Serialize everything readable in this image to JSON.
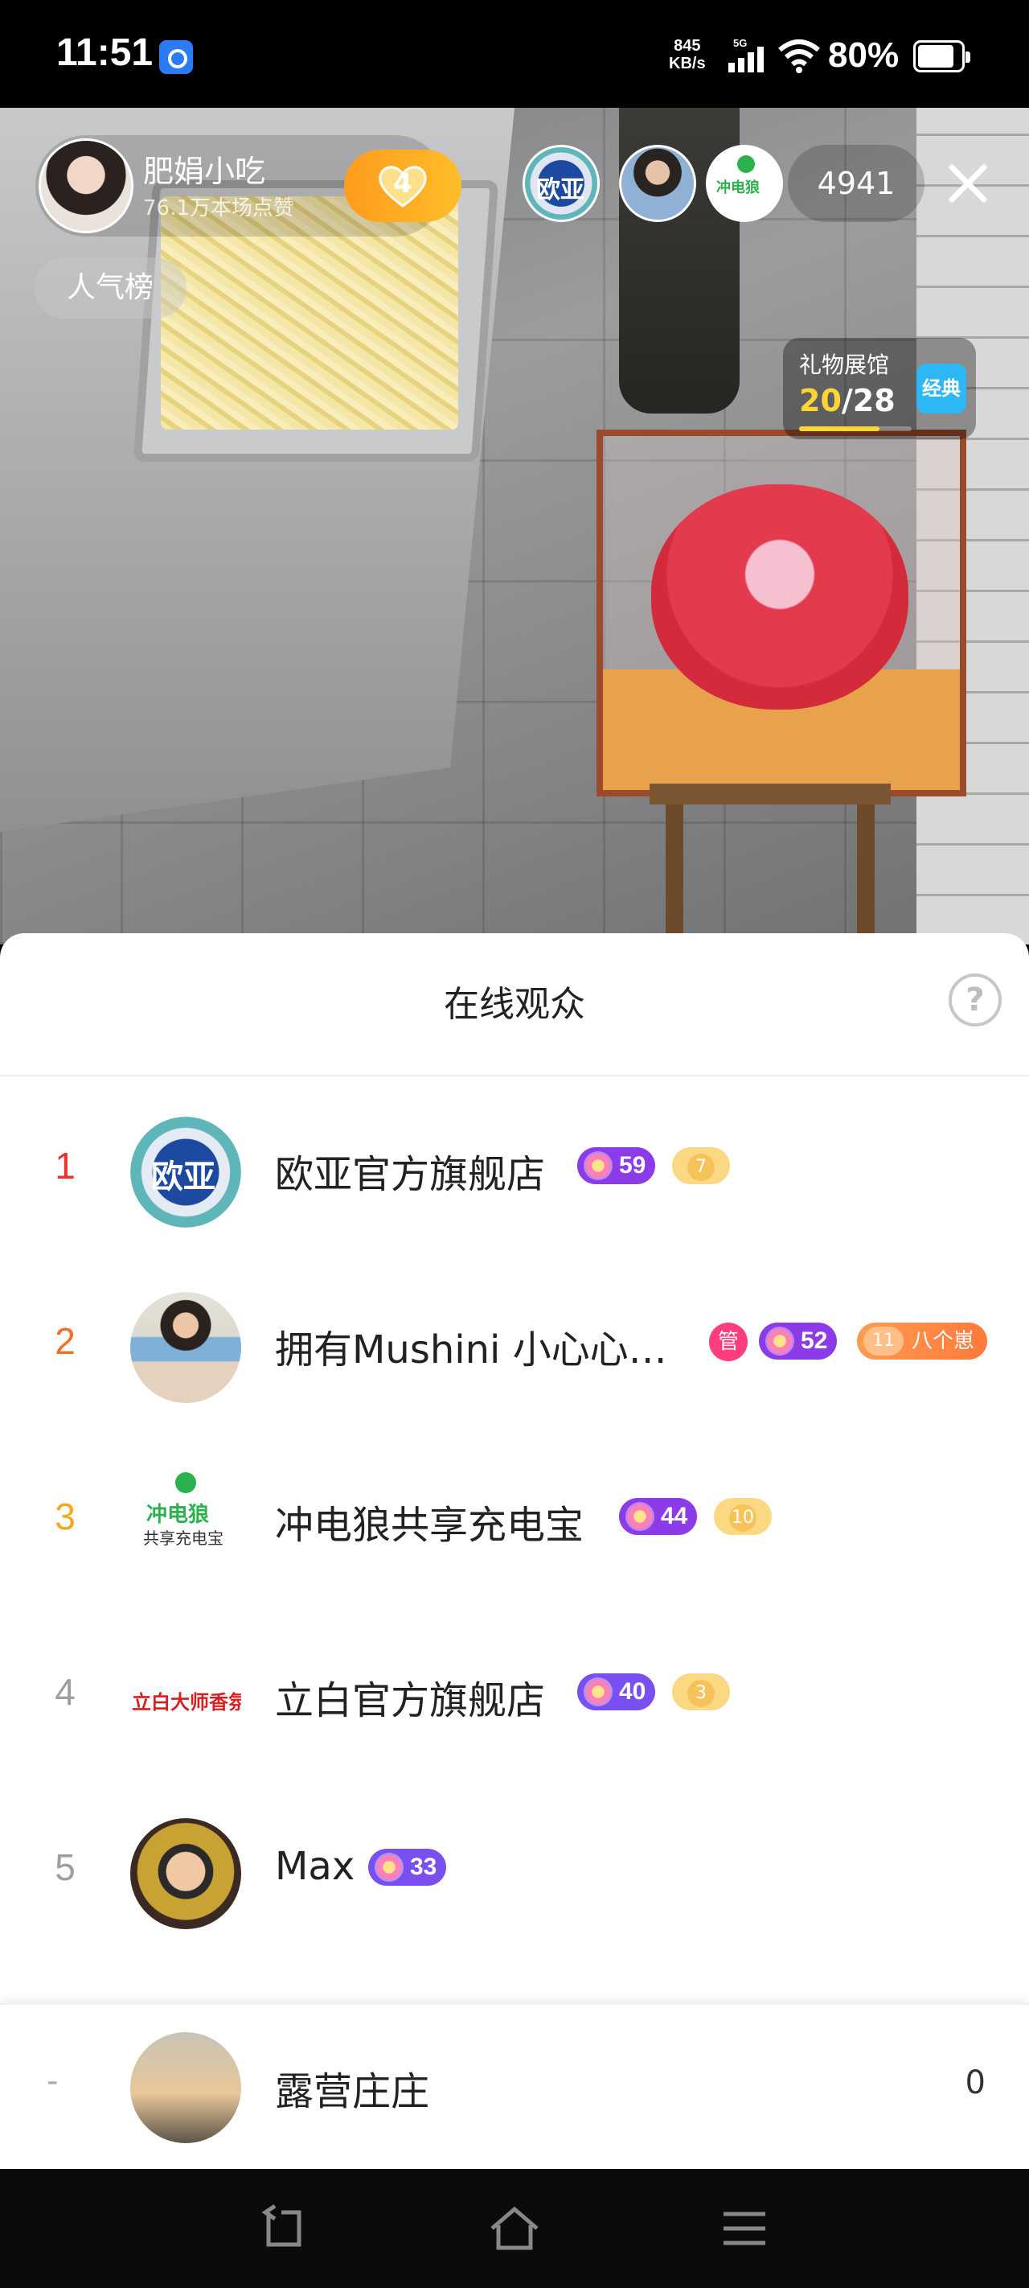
{
  "status_bar": {
    "time": "11:51",
    "net_speed_value": "845",
    "net_speed_unit": "KB/s",
    "network": "5G",
    "battery_percent": "80%",
    "battery_level": 0.8
  },
  "live": {
    "host_name": "肥娟小吃",
    "host_likes": "76.1万本场点赞",
    "follow_badge_number": "4",
    "popularity_label": "人气榜",
    "viewer_count": "4941",
    "top_viewer_avatars": [
      "欧亚官方旗舰店",
      "拥有Mushini 小心心…",
      "冲电狼共享充电宝"
    ],
    "gift_hall": {
      "label": "礼物展馆",
      "current": "20",
      "total": "/28",
      "progress": 0.714,
      "badge": "经典"
    }
  },
  "sheet": {
    "title": "在线观众",
    "viewers": [
      {
        "rank": "1",
        "rank_color": "#f0302f",
        "name": "欧亚官方旗舰店",
        "fan_level": "59",
        "fan_color": "#8b3be8",
        "coin": "7"
      },
      {
        "rank": "2",
        "rank_color": "#f06f2a",
        "name": "拥有Mushini 小心心…",
        "manager": "管",
        "fan_level": "52",
        "fan_color": "#8b3be8",
        "group_level": "11",
        "group_name": "八个崽"
      },
      {
        "rank": "3",
        "rank_color": "#f3a91a",
        "name": "冲电狼共享充电宝",
        "fan_level": "44",
        "fan_color": "#8b3be8",
        "coin": "10"
      },
      {
        "rank": "4",
        "rank_color": "#9e9e9e",
        "name": "立白官方旗舰店",
        "fan_level": "40",
        "fan_color": "#7a4ff0",
        "coin": "3"
      },
      {
        "rank": "5",
        "rank_color": "#9e9e9e",
        "name": "Max",
        "fan_level": "33",
        "fan_color": "#7a4ff0"
      }
    ],
    "self": {
      "rank": "-",
      "name": "露营庄庄",
      "score": "0"
    }
  }
}
